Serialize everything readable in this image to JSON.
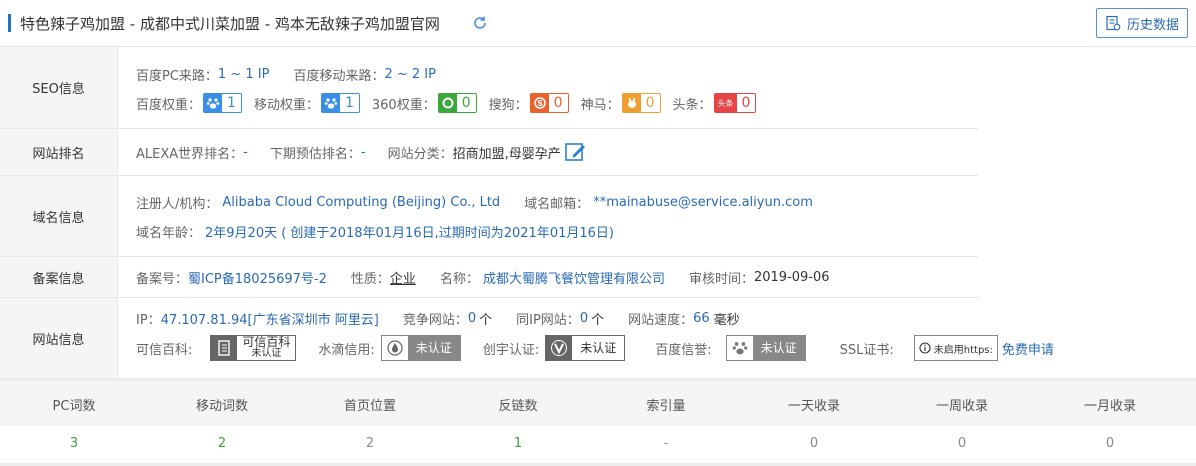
{
  "header": {
    "title": "特色辣子鸡加盟 - 成都中式川菜加盟 - 鸡本无敌辣子鸡加盟官网",
    "history_button": "历史数据"
  },
  "seo": {
    "label": "SEO信息",
    "baidu_pc_source_label": "百度PC来路：",
    "baidu_pc_source": "1 ~ 1 IP",
    "baidu_mobile_source_label": "百度移动来路：",
    "baidu_mobile_source": "2 ~ 2 IP",
    "weights": [
      {
        "label": "百度权重：",
        "icon": "baidu-paw-icon",
        "value": "1",
        "color": "#3a8ee6"
      },
      {
        "label": "移动权重：",
        "icon": "baidu-paw-icon",
        "value": "1",
        "color": "#3a8ee6"
      },
      {
        "label": "360权重：",
        "icon": "360-icon",
        "value": "0",
        "color": "#3aa83a"
      },
      {
        "label": "搜狗：",
        "icon": "sogou-icon",
        "value": "0",
        "color": "#e8622e"
      },
      {
        "label": "神马：",
        "icon": "shenma-icon",
        "value": "0",
        "color": "#f0a030"
      },
      {
        "label": "头条：",
        "icon": "toutiao-icon",
        "icon_text": "头条",
        "value": "0",
        "color": "#e64545"
      }
    ]
  },
  "rank": {
    "label": "网站排名",
    "alexa_label": "ALEXA世界排名：",
    "alexa_value": "-",
    "next_label": "下期预估排名：",
    "next_value": "-",
    "category_label": "网站分类：",
    "category_value": "招商加盟,母婴孕产"
  },
  "domain": {
    "label": "域名信息",
    "registrant_label": "注册人/机构：",
    "registrant_value": "Alibaba Cloud Computing (Beijing) Co., Ltd",
    "email_label": "域名邮箱：",
    "email_value": "**mainabuse@service.aliyun.com",
    "age_label": "域名年龄：",
    "age_value": "2年9月20天 ( 创建于2018年01月16日,过期时间为2021年01月16日)"
  },
  "beian": {
    "label": "备案信息",
    "no_label": "备案号：",
    "no_value": "蜀ICP备18025697号-2",
    "nature_label": "性质：",
    "nature_value": "企业",
    "name_label": "名称：",
    "name_value": "成都大蜀腾飞餐饮管理有限公司",
    "audit_label": "审核时间：",
    "audit_value": "2019-09-06"
  },
  "site": {
    "label": "网站信息",
    "ip_label": "IP：",
    "ip_value": "47.107.81.94[广东省深圳市 阿里云]",
    "compete_label": "竞争网站：",
    "compete_value": "0",
    "compete_unit": "个",
    "sameip_label": "同IP网站：",
    "sameip_value": "0",
    "sameip_unit": "个",
    "speed_label": "网站速度：",
    "speed_value": "66",
    "speed_unit": "毫秒",
    "kexin_label": "可信百科:",
    "kexin_badge_line1": "可信百科",
    "kexin_badge_line2": "未认证",
    "shuidi_label": "水滴信用:",
    "shuidi_badge": "未认证",
    "chuangyu_label": "创宇认证:",
    "chuangyu_badge": "未认证",
    "baidu_credit_label": "百度信誉:",
    "baidu_credit_badge": "未认证",
    "ssl_label": "SSL证书:",
    "ssl_badge": "未启用https:",
    "ssl_link": "免费申请"
  },
  "stats": {
    "headers": [
      "PC词数",
      "移动词数",
      "首页位置",
      "反链数",
      "索引量",
      "一天收录",
      "一周收录",
      "一月收录"
    ],
    "values": [
      "3",
      "2",
      "2",
      "1",
      "-",
      "0",
      "0",
      "0"
    ]
  },
  "colors": {
    "accent": "#1f73c6",
    "link": "#2a6ab5",
    "green": "#3c9c3c"
  }
}
